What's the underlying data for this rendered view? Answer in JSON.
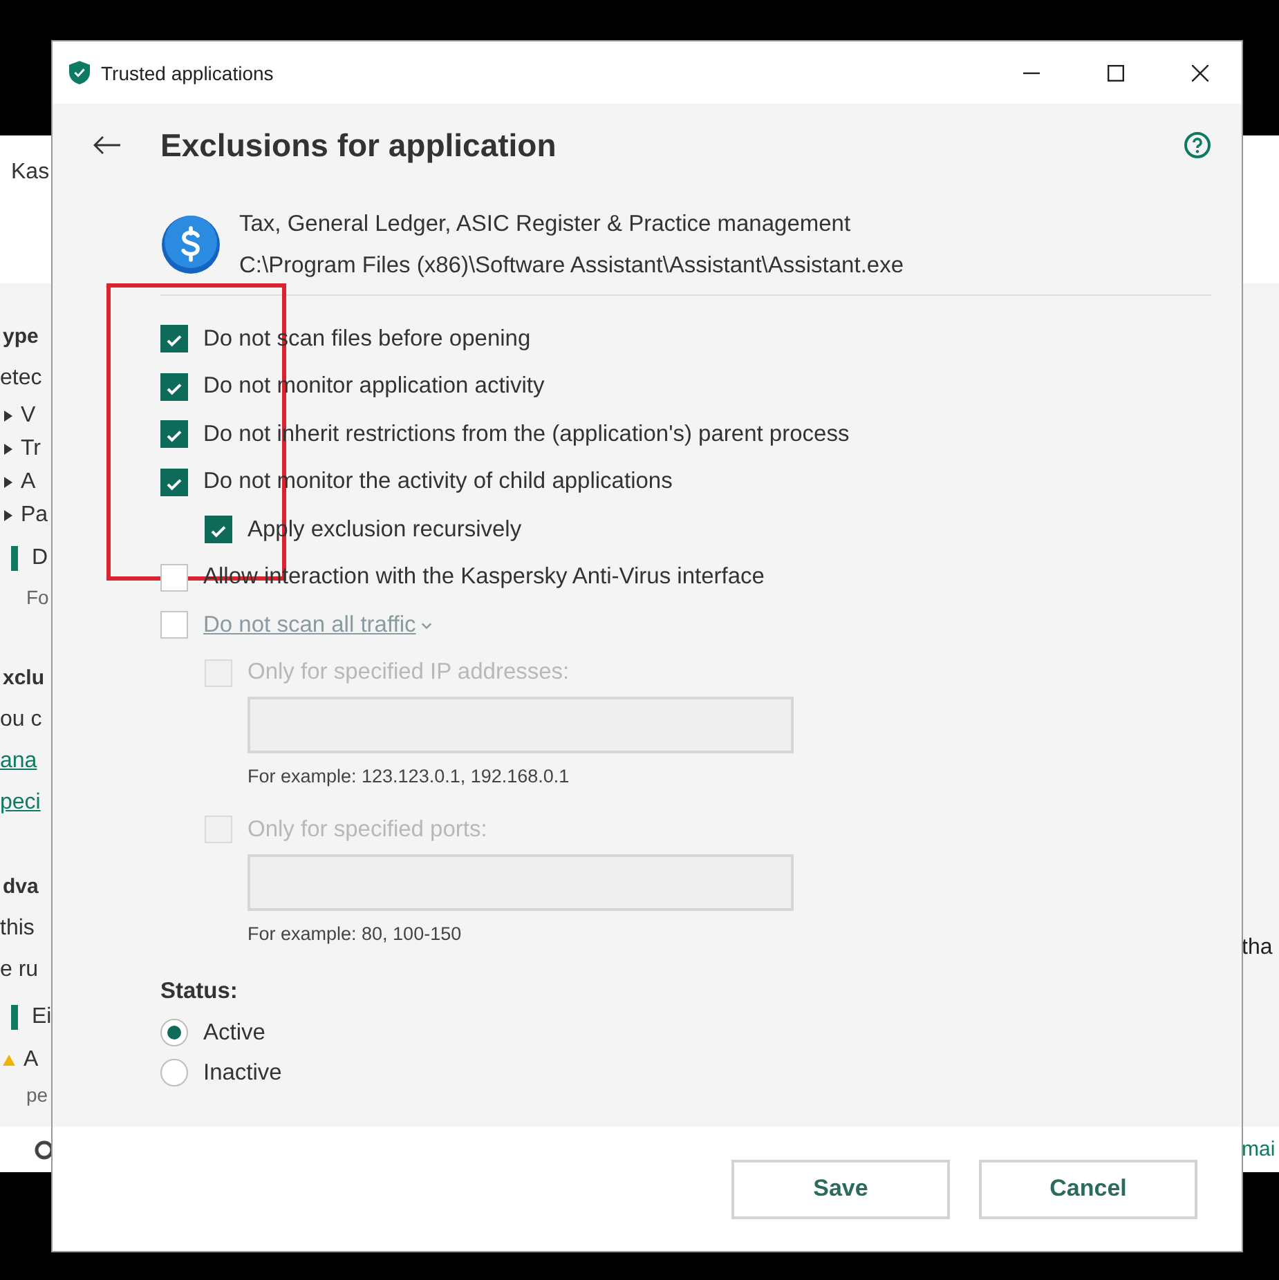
{
  "background_window": {
    "title": "Kas",
    "items": [
      {
        "kind": "heading",
        "text": "ype"
      },
      {
        "kind": "text",
        "text": "etec"
      },
      {
        "kind": "bullet",
        "text": "V"
      },
      {
        "kind": "bullet",
        "text": "Tr"
      },
      {
        "kind": "bullet",
        "text": "A"
      },
      {
        "kind": "bullet",
        "text": "Pa"
      },
      {
        "kind": "accent",
        "text": "D"
      },
      {
        "kind": "subtext",
        "text": "Fo"
      },
      {
        "kind": "heading",
        "text": "xclu"
      },
      {
        "kind": "text",
        "text": "ou c"
      },
      {
        "kind": "link",
        "text": "ana"
      },
      {
        "kind": "link",
        "text": "peci"
      },
      {
        "kind": "heading",
        "text": "dva"
      },
      {
        "kind": "text",
        "text": "this"
      },
      {
        "kind": "text",
        "text": "e ru"
      },
      {
        "kind": "accent",
        "text": "Ei"
      },
      {
        "kind": "warning",
        "text": "A"
      },
      {
        "kind": "subtext",
        "text": "pe"
      }
    ],
    "right_text": "tha",
    "footer_link": "mai"
  },
  "dialog": {
    "title": "Trusted applications",
    "heading": "Exclusions for application",
    "application": {
      "name": "Tax, General Ledger, ASIC Register & Practice management",
      "path": "C:\\Program Files (x86)\\Software Assistant\\Assistant\\Assistant.exe"
    },
    "options": [
      {
        "kind": "checkbox",
        "label": "Do not scan files before opening",
        "checked": true,
        "disabled": false
      },
      {
        "kind": "checkbox",
        "label": "Do not monitor application activity",
        "checked": true,
        "disabled": false
      },
      {
        "kind": "checkbox",
        "label": "Do not inherit restrictions from the (application's) parent process",
        "checked": true,
        "disabled": false
      },
      {
        "kind": "checkbox",
        "label": "Do not monitor the activity of child applications",
        "checked": true,
        "disabled": false,
        "children": [
          {
            "kind": "checkbox",
            "label": "Apply exclusion recursively",
            "checked": true,
            "disabled": false
          }
        ]
      },
      {
        "kind": "checkbox",
        "label": "Allow interaction with the Kaspersky Anti-Virus interface",
        "checked": false,
        "disabled": false
      },
      {
        "kind": "link",
        "label": "Do not scan all traffic",
        "checked": false,
        "disabled": false,
        "children": [
          {
            "kind": "field",
            "label": "Only for specified IP addresses:",
            "checked": false,
            "disabled": true,
            "hint": "For example: 123.123.0.1, 192.168.0.1"
          },
          {
            "kind": "field",
            "label": "Only for specified ports:",
            "checked": false,
            "disabled": true,
            "hint": "For example: 80, 100-150"
          }
        ]
      }
    ],
    "status_label": "Status:",
    "status": [
      {
        "label": "Active",
        "selected": true
      },
      {
        "label": "Inactive",
        "selected": false
      }
    ],
    "buttons": [
      "Save",
      "Cancel"
    ]
  }
}
